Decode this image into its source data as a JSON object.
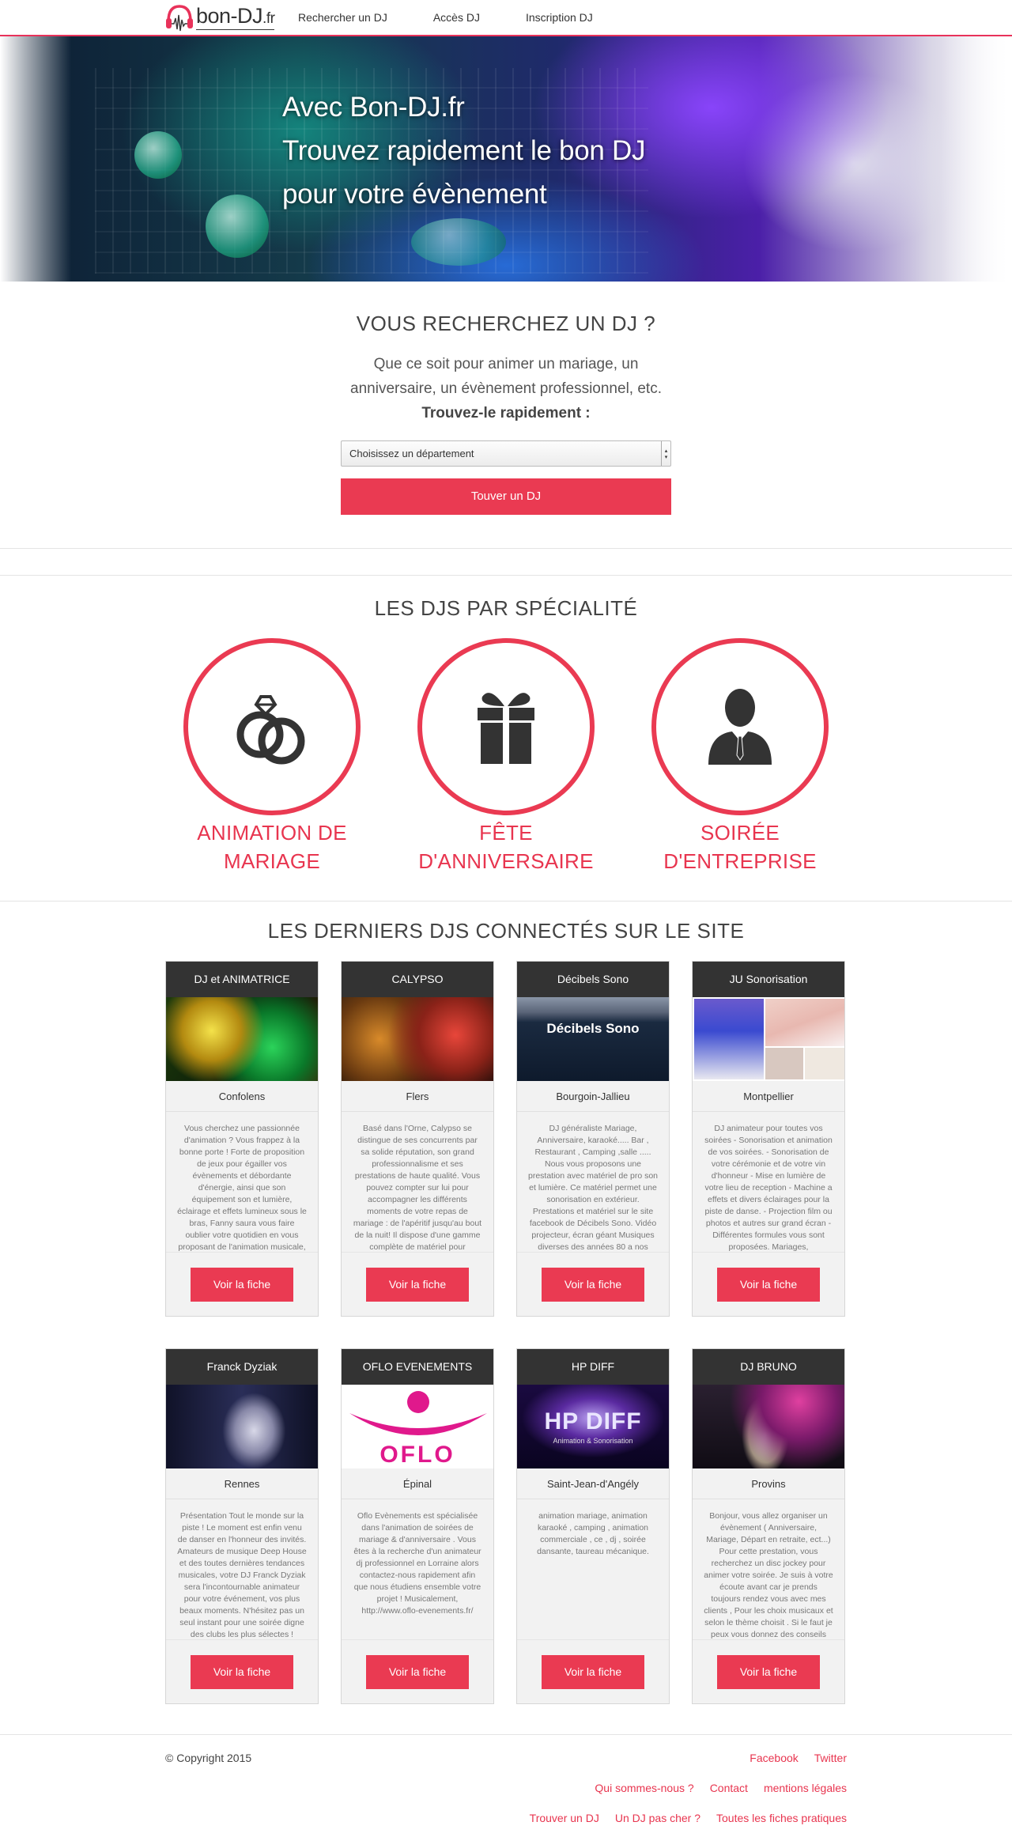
{
  "brand": {
    "name": "bon-DJ",
    "tld": ".fr"
  },
  "nav": {
    "items": [
      "Rechercher un DJ",
      "Accès DJ",
      "Inscription DJ"
    ]
  },
  "hero": {
    "lines": [
      "Avec Bon-DJ.fr",
      "Trouvez rapidement le bon DJ",
      "pour votre évènement"
    ]
  },
  "search": {
    "title": "VOUS RECHERCHEZ UN DJ ?",
    "lead_1": "Que ce soit pour animer un mariage, un",
    "lead_2": "anniversaire, un évènement professionnel, etc.",
    "strong": "Trouvez-le rapidement :",
    "select_value": "Choisissez un département",
    "button": "Touver un DJ"
  },
  "specialties": {
    "title": "LES DJS PAR SPÉCIALITÉ",
    "items": [
      {
        "line1": "ANIMATION DE",
        "line2": "MARIAGE",
        "icon": "wedding-rings-icon"
      },
      {
        "line1": "FÊTE",
        "line2": "D'ANNIVERSAIRE",
        "icon": "gift-icon"
      },
      {
        "line1": "SOIRÉE",
        "line2": "D'ENTREPRISE",
        "icon": "businessman-icon"
      }
    ]
  },
  "djs": {
    "title": "LES DERNIERS DJS CONNECTÉS SUR LE SITE",
    "button": "Voir la fiche",
    "cards": [
      {
        "name": "DJ et ANIMATRICE",
        "city": "Confolens",
        "desc": "Vous cherchez une passionnée d'animation ? Vous frappez à la bonne porte ! Forte de proposition de jeux pour égailler vos évènements et débordante d'énergie, ainsi que son équipement son et lumière, éclairage et effets lumineux sous le bras, Fanny saura vous faire oublier votre quotidien en vous proposant de l'animation musicale,"
      },
      {
        "name": "CALYPSO",
        "city": "Flers",
        "desc": "Basé dans l'Orne, Calypso se distingue de ses concurrents par sa solide réputation, son grand professionnalisme et ses prestations de haute qualité. Vous pouvez compter sur lui pour accompagner les différents moments de votre repas de mariage : de l'apéritif jusqu'au bout de la nuit! Il dispose d'une gamme complète de matériel pour"
      },
      {
        "name": "Décibels Sono",
        "city": "Bourgoin-Jallieu",
        "desc": "DJ généraliste Mariage, Anniversaire, karaoké..... Bar , Restaurant , Camping ,salle ..... Nous vous proposons une prestation avec matériel de pro son et lumière. Ce matériel permet une sonorisation en extérieur. Prestations et matériel sur le site facebook de Décibels Sono. Vidéo projecteur, écran géant Musiques diverses des années 80 a nos"
      },
      {
        "name": "JU Sonorisation",
        "city": "Montpellier",
        "desc": "DJ animateur pour toutes vos soirées - Sonorisation et animation de vos soirées. - Sonorisation de votre cérémonie et de votre vin d'honneur - Mise en lumière de votre lieu de reception - Machine a effets et divers éclairages pour la piste de danse. - Projection film ou photos et autres sur grand écran - Différentes formules vous sont proposées. Mariages,"
      },
      {
        "name": "Franck Dyziak",
        "city": "Rennes",
        "desc": "Présentation Tout le monde sur la piste ! Le moment est enfin venu de danser en l'honneur des invités. Amateurs de musique Deep House et des toutes dernières tendances musicales, votre DJ Franck Dyziak sera l'incontournable animateur pour votre événement, vos plus beaux moments. N'hésitez pas un seul instant pour une soirée digne des clubs les plus sélectes !"
      },
      {
        "name": "OFLO EVENEMENTS",
        "city": "Épinal",
        "desc": "Oflo Evènements est spécialisée dans l'animation de soirées de mariage & d'anniversaire . Vous êtes à la recherche d'un animateur dj professionnel en Lorraine alors contactez-nous rapidement afin que nous étudiens ensemble votre projet ! Musicalement, http://www.oflo-evenements.fr/"
      },
      {
        "name": "HP DIFF",
        "city": "Saint-Jean-d'Angély",
        "desc": "animation mariage, animation karaoké , camping , animation commerciale , ce , dj , soirée dansante, taureau mécanique."
      },
      {
        "name": "DJ BRUNO",
        "city": "Provins",
        "desc": "Bonjour, vous allez organiser un évènement ( Anniversaire, Mariage, Départ en retraite, ect...) Pour cette prestation, vous recherchez un disc jockey pour animer votre soirée. Je suis à votre écoute avant car je prends toujours rendez vous avec mes clients , Pour les choix musicaux et selon le thème choisit . Si le faut je peux vous donnez des conseils pour la"
      }
    ]
  },
  "images": {
    "card_6_text": "OFLO",
    "card_7_text": "HP DIFF",
    "card_7_sub": "Animation & Sonorisation",
    "card_3_text": "Décibels Sono"
  },
  "footer": {
    "copyright": "© Copyright 2015",
    "row1": [
      "Facebook",
      "Twitter"
    ],
    "row2": [
      "Qui sommes-nous ?",
      "Contact",
      "mentions légales"
    ],
    "row3": [
      "Trouver un DJ",
      "Un DJ pas cher ?",
      "Toutes les fiches pratiques"
    ]
  },
  "colors": {
    "accent": "#ea3a52",
    "dark": "#333333"
  }
}
